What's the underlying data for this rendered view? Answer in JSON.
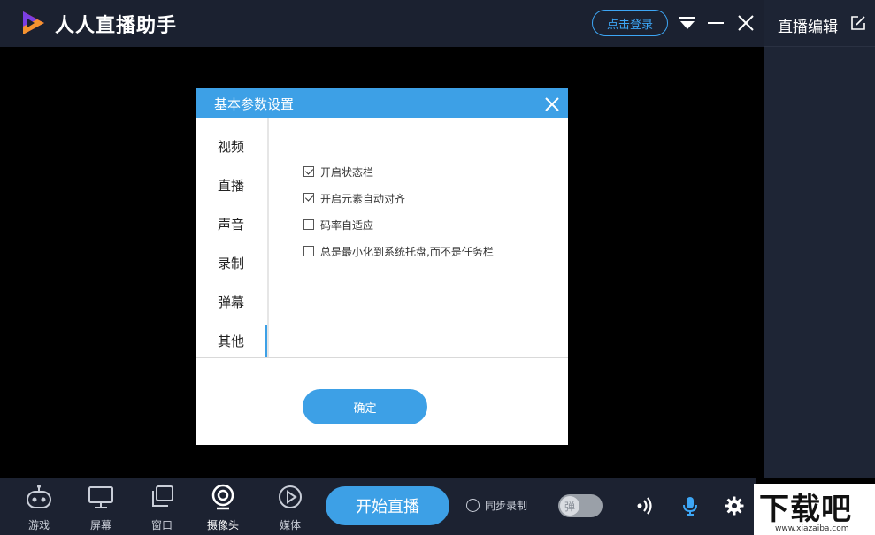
{
  "app": {
    "title": "人人直播助手",
    "login_label": "点击登录"
  },
  "right_panel": {
    "title": "直播编辑"
  },
  "dialog": {
    "title": "基本参数设置",
    "nav": [
      "视频",
      "直播",
      "声音",
      "录制",
      "弹幕",
      "其他"
    ],
    "active_nav": "其他",
    "options": [
      {
        "label": "开启状态栏",
        "checked": true
      },
      {
        "label": "开启元素自动对齐",
        "checked": true
      },
      {
        "label": "码率自适应",
        "checked": false
      },
      {
        "label": "总是最小化到系统托盘,而不是任务栏",
        "checked": false
      }
    ],
    "ok_label": "确定"
  },
  "bottom_bar": {
    "sources": [
      {
        "label": "游戏",
        "icon": "gamepad-icon"
      },
      {
        "label": "屏幕",
        "icon": "monitor-icon"
      },
      {
        "label": "窗口",
        "icon": "window-icon"
      },
      {
        "label": "摄像头",
        "icon": "camera-icon"
      },
      {
        "label": "媒体",
        "icon": "play-icon"
      }
    ],
    "start_live_label": "开始直播",
    "sync_record_label": "同步录制",
    "danmu_toggle_label": "弹"
  },
  "watermark": {
    "text": "下载吧",
    "url": "www.xiazaiba.com"
  },
  "colors": {
    "accent": "#3da0e6",
    "dark_bg": "#1b2130",
    "mic": "#3da6f5"
  }
}
